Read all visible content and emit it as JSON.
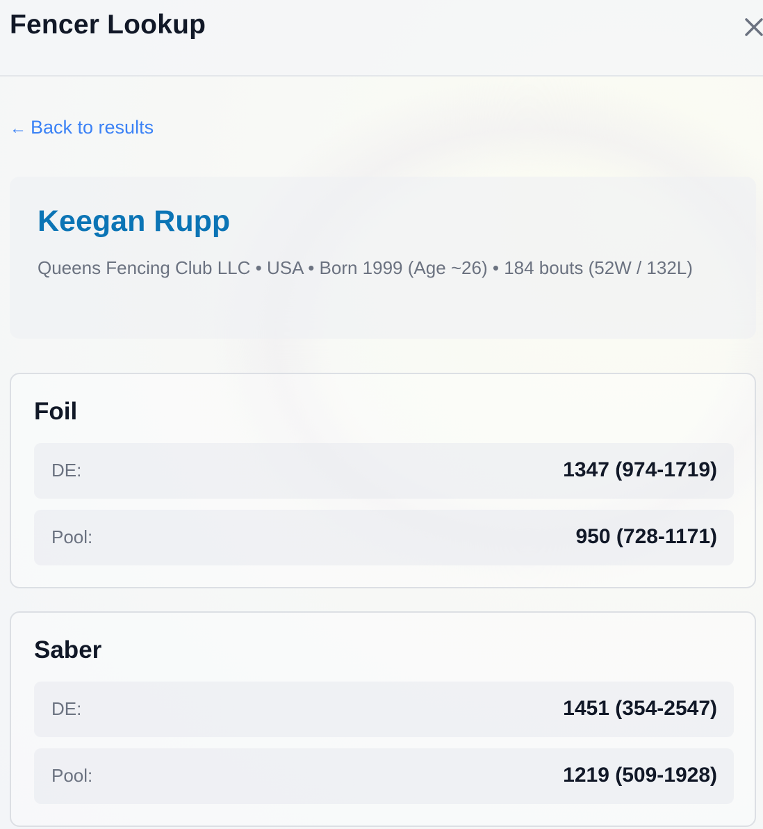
{
  "header": {
    "title": "Fencer Lookup",
    "close_icon": "close-icon"
  },
  "nav": {
    "back_arrow": "←",
    "back_label": "Back to results"
  },
  "profile": {
    "name": "Keegan Rupp",
    "meta": "Queens Fencing Club LLC • USA • Born 1999 (Age ~26) • 184 bouts (52W / 132L)"
  },
  "weapons": [
    {
      "name": "Foil",
      "ratings": [
        {
          "label": "DE:",
          "value": "1347 (974-1719)"
        },
        {
          "label": "Pool:",
          "value": "950 (728-1171)"
        }
      ]
    },
    {
      "name": "Saber",
      "ratings": [
        {
          "label": "DE:",
          "value": "1451 (354-2547)"
        },
        {
          "label": "Pool:",
          "value": "1219 (509-1928)"
        }
      ]
    }
  ],
  "colors": {
    "accent_link": "#3b82f6",
    "name_blue": "#0b74b5",
    "text_muted": "#6b7280",
    "text_dark": "#111827"
  }
}
